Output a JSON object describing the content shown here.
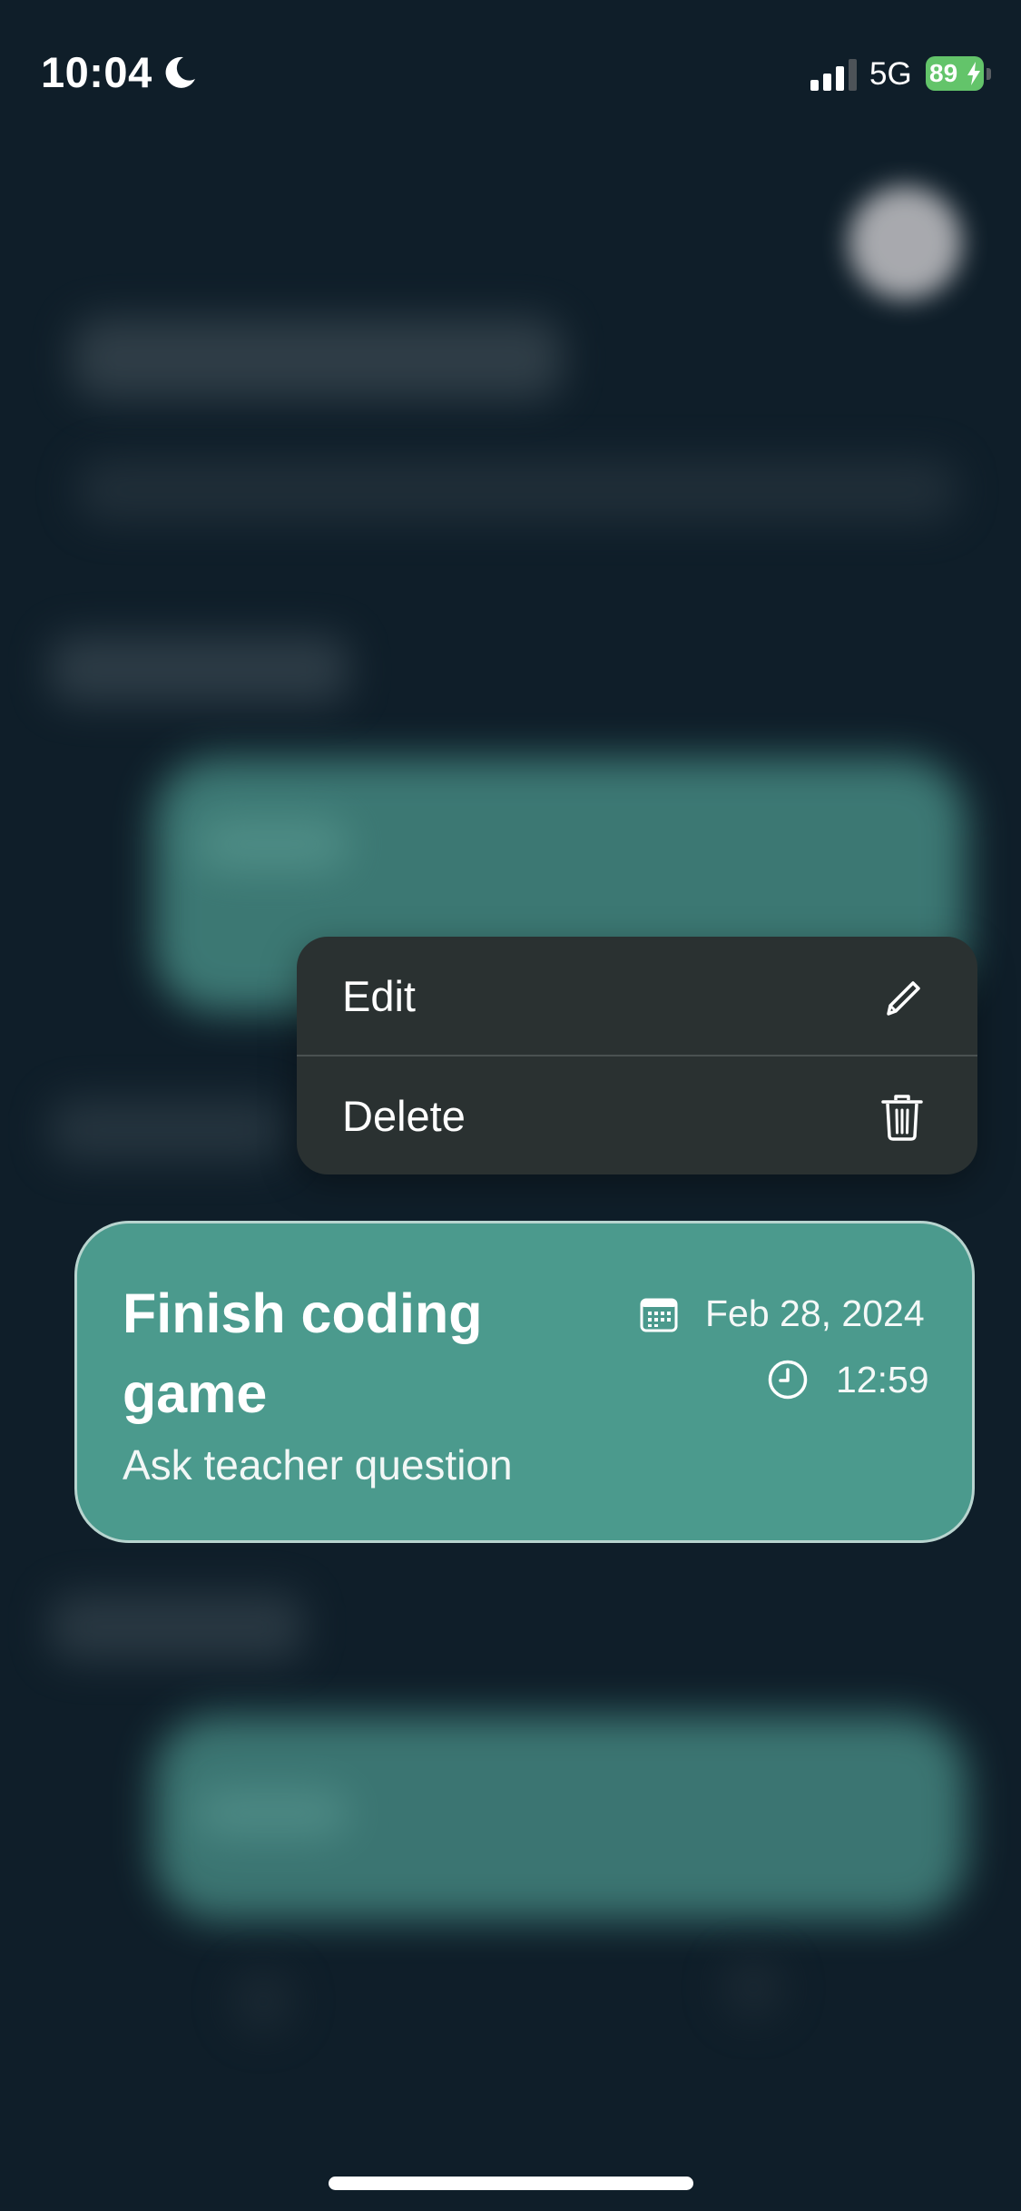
{
  "status_bar": {
    "time": "10:04",
    "network": "5G",
    "battery_level": "89",
    "icons": [
      "moon-icon",
      "signal-icon",
      "battery-icon",
      "bolt-icon"
    ]
  },
  "context_menu": {
    "items": [
      {
        "label": "Edit",
        "icon": "pencil-icon"
      },
      {
        "label": "Delete",
        "icon": "trash-icon"
      }
    ]
  },
  "task": {
    "title": "Finish coding game",
    "note": "Ask teacher question",
    "date": "Feb 28, 2024",
    "time": "12:59",
    "icons": [
      "calendar-icon",
      "clock-icon"
    ]
  },
  "colors": {
    "background": "#0f1e29",
    "card": "#4b9a8d",
    "card_border": "#b8d4cf",
    "menu": "#2a3131",
    "battery": "#63c46a"
  }
}
